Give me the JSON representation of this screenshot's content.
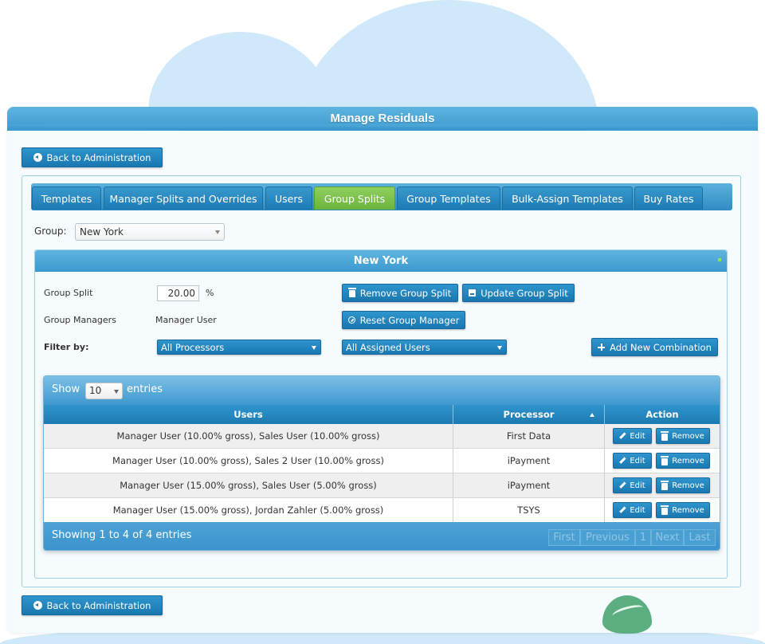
{
  "window": {
    "title": "Manage Residuals"
  },
  "back_button": {
    "label": "Back to Administration"
  },
  "tabs": [
    {
      "label": "Templates"
    },
    {
      "label": "Manager Splits and Overrides"
    },
    {
      "label": "Users"
    },
    {
      "label": "Group Splits",
      "active": true
    },
    {
      "label": "Group Templates"
    },
    {
      "label": "Bulk-Assign Templates"
    },
    {
      "label": "Buy Rates"
    }
  ],
  "group_select": {
    "label": "Group:",
    "value": "New York"
  },
  "group_panel": {
    "title": "New York",
    "group_split": {
      "label": "Group Split",
      "value": "20.00",
      "unit": "%"
    },
    "group_managers": {
      "label": "Group Managers",
      "value": "Manager User"
    },
    "filter": {
      "label": "Filter by:",
      "processor": "All Processors",
      "users": "All Assigned Users"
    },
    "buttons": {
      "remove_split": "Remove Group Split",
      "update_split": "Update Group Split",
      "reset_manager": "Reset Group Manager",
      "add_combination": "Add New Combination"
    }
  },
  "table": {
    "show_label": "Show",
    "entries_label": "entries",
    "page_length": "10",
    "columns": [
      "Users",
      "Processor",
      "Action"
    ],
    "rows": [
      {
        "users": "Manager User (10.00% gross), Sales User (10.00% gross)",
        "processor": "First Data"
      },
      {
        "users": "Manager User (10.00% gross), Sales 2 User (10.00% gross)",
        "processor": "iPayment"
      },
      {
        "users": "Manager User (15.00% gross), Sales User (5.00% gross)",
        "processor": "iPayment"
      },
      {
        "users": "Manager User (15.00% gross), Jordan Zahler (5.00% gross)",
        "processor": "TSYS"
      }
    ],
    "row_actions": {
      "edit": "Edit",
      "remove": "Remove"
    },
    "info": "Showing 1 to 4 of 4 entries",
    "pager": {
      "first": "First",
      "previous": "Previous",
      "page": "1",
      "next": "Next",
      "last": "Last"
    }
  },
  "colors": {
    "primary": "#2585c0",
    "active_tab": "#7cc24a",
    "background": "#f6fbfe",
    "cloud": "#cfe8fa"
  }
}
